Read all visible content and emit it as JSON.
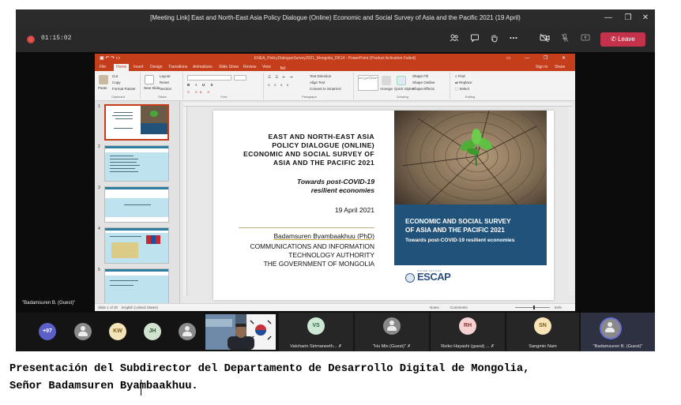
{
  "window": {
    "title": "[Meeting Link] East and North-East Asia Policy Dialogue (Online) Economic and Social Survey of Asia and the Pacific 2021 (19 April)",
    "controls": [
      "—",
      "❐",
      "✕"
    ]
  },
  "meeting": {
    "timer": "01:15:02",
    "leave_label": "Leave",
    "icons": [
      "people-icon",
      "chat-icon",
      "raise-hand-icon",
      "more-icon",
      "camera-off-icon",
      "mic-off-icon",
      "share-icon"
    ]
  },
  "powerpoint": {
    "title": "ENEA_PolicyDialogueSurvey2021_Mongolia_DK14 - PowerPoint (Product Activation Failed)",
    "tabs": [
      "File",
      "Home",
      "Insert",
      "Design",
      "Transitions",
      "Animations",
      "Slide Show",
      "Review",
      "View"
    ],
    "tell_me": "Tell me what you want to do...",
    "sign_in": "Sign in",
    "share": "Share",
    "ribbon": {
      "clipboard": {
        "label": "Clipboard",
        "paste": "Paste",
        "cut": "Cut",
        "copy": "Copy",
        "format_painter": "Format Painter"
      },
      "slides": {
        "label": "Slides",
        "new_slide": "New Slide",
        "layout": "Layout",
        "reset": "Reset",
        "section": "Section"
      },
      "font": {
        "label": "Font"
      },
      "paragraph": {
        "label": "Paragraph",
        "text_direction": "Text Direction",
        "align_text": "Align Text",
        "smartart": "Convert to SmartArt"
      },
      "drawing": {
        "label": "Drawing",
        "arrange": "Arrange",
        "quick_styles": "Quick Styles",
        "shape_fill": "Shape Fill",
        "shape_outline": "Shape Outline",
        "shape_effects": "Shape Effects"
      },
      "editing": {
        "label": "Editing",
        "find": "Find",
        "replace": "Replace",
        "select": "Select"
      }
    },
    "thumb_numbers": [
      "1",
      "2",
      "3",
      "4",
      "5"
    ],
    "status": {
      "slide": "Slide 1 of 30",
      "language": "English (United States)",
      "notes": "Notes",
      "comments": "Comments",
      "zoom": "64%"
    }
  },
  "slide": {
    "title_lines": [
      "EAST AND NORTH-EAST ASIA",
      "POLICY DIALOGUE (ONLINE)",
      "ECONOMIC AND SOCIAL SURVEY OF",
      "ASIA AND THE PACIFIC 2021"
    ],
    "subtitle_lines": [
      "Towards post-COVID-19",
      "resilient economies"
    ],
    "date": "19 April 2021",
    "speaker": "Badamsuren Byambaakhuu (PhD)",
    "org_lines": [
      "COMMUNICATIONS AND INFORMATION",
      "TECHNOLOGY AUTHORITY",
      "THE GOVERNMENT OF MONGOLIA"
    ],
    "cover_title_lines": [
      "ECONOMIC AND SOCIAL SURVEY",
      "OF ASIA AND THE PACIFIC 2021"
    ],
    "cover_subtitle": "Towards post-COVID-19 resilient economies",
    "logo": "ESCAP",
    "logo_small": "UNITED NATIONS"
  },
  "presenter_label": "\"Badamsuren B. (Guest)\"",
  "participants": {
    "overflow_count": "+97",
    "avatars": [
      {
        "initials": "",
        "color": "#8a8a8a"
      },
      {
        "initials": "KW",
        "color": "#f3e3b8"
      },
      {
        "initials": "JH",
        "color": "#cfe3cf"
      },
      {
        "initials": "",
        "color": "#8a8a8a"
      }
    ],
    "tiles": [
      {
        "initials": "VS",
        "name": "Vatcharin Sirimaneeth...",
        "color": "#cde9d6"
      },
      {
        "initials": "",
        "name": "\"Hu Min (Guest)\"",
        "color": "#8a8a8a"
      },
      {
        "initials": "RH",
        "name": "Reiko Hayashi (guest) ...",
        "color": "#f6d2d2"
      },
      {
        "initials": "SN",
        "name": "Sangmin Nam",
        "color": "#f7e3b6"
      }
    ],
    "self_name": "\"Badamsuren B. (Guest)\""
  },
  "caption": {
    "line1": "Presentación del Subdirector del Departamento de Desarrollo Digital de Mongolia,",
    "line2": "Señor Badamsuren Byambaakhuu."
  }
}
